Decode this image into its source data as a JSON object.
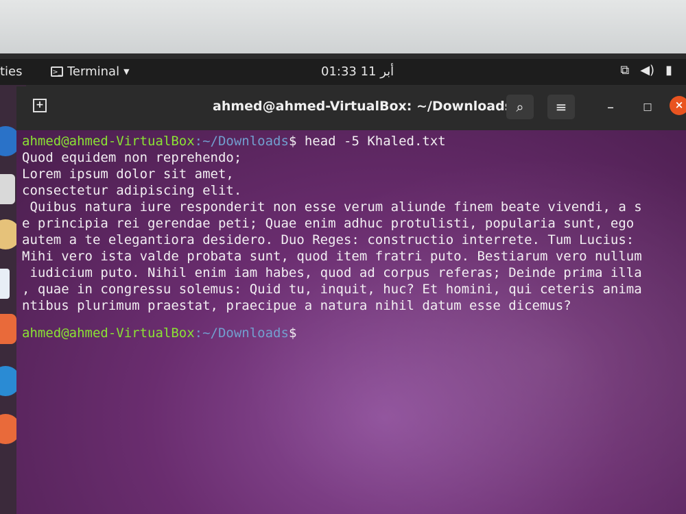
{
  "topbar": {
    "activities_label": "ties",
    "app_name": "Terminal",
    "clock": "01:33  11 أبر"
  },
  "window": {
    "title": "ahmed@ahmed-VirtualBox: ~/Downloads"
  },
  "terminal": {
    "prompt_user": "ahmed@ahmed-VirtualBox",
    "prompt_path": ":~/Downloads",
    "prompt_symbol": "$",
    "command": " head -5 Khaled.txt",
    "output": [
      "Quod equidem non reprehendo;",
      "Lorem ipsum dolor sit amet,",
      "consectetur adipiscing elit.",
      " Quibus natura iure responderit non esse verum aliunde finem beate vivendi, a s",
      "e principia rei gerendae peti; Quae enim adhuc protulisti, popularia sunt, ego",
      "autem a te elegantiora desidero. Duo Reges: constructio interrete. Tum Lucius:",
      "Mihi vero ista valde probata sunt, quod item fratri puto. Bestiarum vero nullum",
      " iudicium puto. Nihil enim iam habes, quod ad corpus referas; Deinde prima illa",
      ", quae in congressu solemus: Quid tu, inquit, huc? Et homini, qui ceteris anima",
      "ntibus plurimum praestat, praecipue a natura nihil datum esse dicemus?"
    ]
  }
}
